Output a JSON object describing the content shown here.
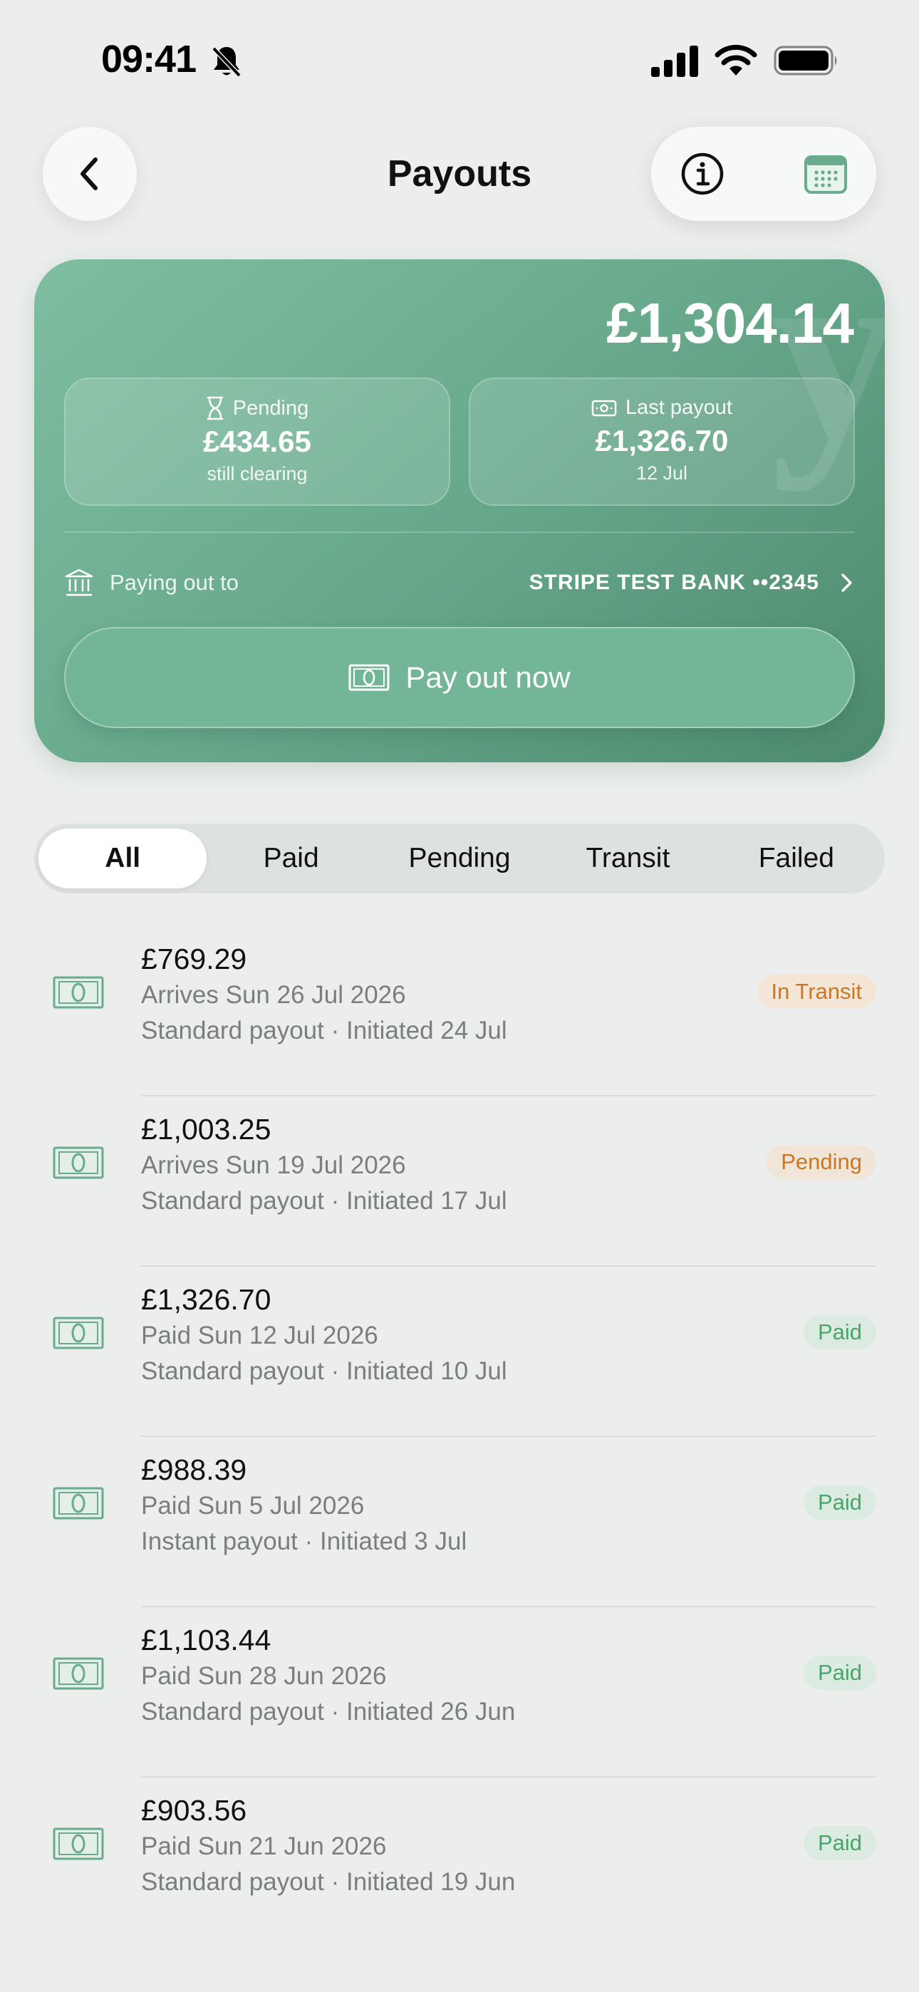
{
  "status_bar": {
    "time": "09:41"
  },
  "header": {
    "title": "Payouts"
  },
  "card": {
    "total": "£1,304.14",
    "pending": {
      "label": "Pending",
      "value": "£434.65",
      "sub": "still clearing"
    },
    "last_payout": {
      "label": "Last payout",
      "value": "£1,326.70",
      "sub": "12 Jul"
    },
    "paying_label": "Paying out to",
    "bank": "STRIPE TEST BANK ••2345",
    "payout_button": "Pay out now"
  },
  "filters": [
    "All",
    "Paid",
    "Pending",
    "Transit",
    "Failed"
  ],
  "payouts": [
    {
      "amount": "£769.29",
      "line1": "Arrives Sun 26 Jul 2026",
      "line2": "Standard payout · Initiated 24 Jul",
      "status": "In Transit"
    },
    {
      "amount": "£1,003.25",
      "line1": "Arrives Sun 19 Jul 2026",
      "line2": "Standard payout · Initiated 17 Jul",
      "status": "Pending"
    },
    {
      "amount": "£1,326.70",
      "line1": "Paid Sun 12 Jul 2026",
      "line2": "Standard payout · Initiated 10 Jul",
      "status": "Paid"
    },
    {
      "amount": "£988.39",
      "line1": "Paid Sun 5 Jul 2026",
      "line2": "Instant payout · Initiated 3 Jul",
      "status": "Paid"
    },
    {
      "amount": "£1,103.44",
      "line1": "Paid Sun 28 Jun 2026",
      "line2": "Standard payout · Initiated 26 Jun",
      "status": "Paid"
    },
    {
      "amount": "£903.56",
      "line1": "Paid Sun 21 Jun 2026",
      "line2": "Standard payout · Initiated 19 Jun",
      "status": "Paid"
    }
  ],
  "icons": {
    "back": "chevron-left-icon",
    "info": "info-icon",
    "calendar": "calendar-icon",
    "hourglass": "hourglass-icon",
    "banknote": "banknote-icon",
    "bank": "bank-icon",
    "chevron": "chevron-right-icon"
  },
  "colors": {
    "accent": "#6aab8e",
    "transit": "#c9782a",
    "paid": "#4aa56a"
  }
}
